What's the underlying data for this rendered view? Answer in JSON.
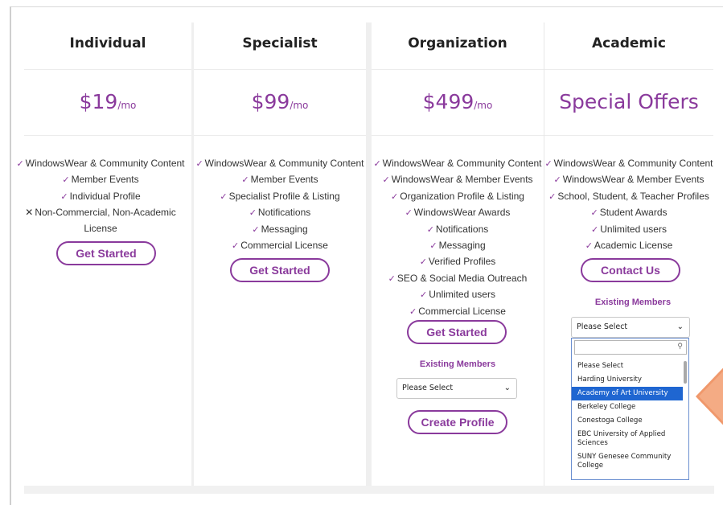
{
  "colors": {
    "accent": "#8a3a9c",
    "highlight": "#1f66d1",
    "pointer": "#f0986b"
  },
  "plans": [
    {
      "title": "Individual",
      "price": "$19",
      "unit": "/mo",
      "features": [
        {
          "icon": "check",
          "text": "WindowsWear & Community Content"
        },
        {
          "icon": "check",
          "text": "Member Events"
        },
        {
          "icon": "check",
          "text": "Individual Profile"
        },
        {
          "icon": "cross",
          "text": "Non-Commercial, Non-Academic"
        },
        {
          "icon": "none",
          "text": "License"
        }
      ],
      "button": "Get Started"
    },
    {
      "title": "Specialist",
      "price": "$99",
      "unit": "/mo",
      "features": [
        {
          "icon": "check",
          "text": "WindowsWear & Community Content"
        },
        {
          "icon": "check",
          "text": "Member Events"
        },
        {
          "icon": "check",
          "text": "Specialist Profile & Listing"
        },
        {
          "icon": "check",
          "text": "Notifications"
        },
        {
          "icon": "check",
          "text": "Messaging"
        },
        {
          "icon": "check",
          "text": "Commercial License"
        }
      ],
      "button": "Get Started"
    },
    {
      "title": "Organization",
      "price": "$499",
      "unit": "/mo",
      "features": [
        {
          "icon": "check",
          "text": "WindowsWear & Community Content"
        },
        {
          "icon": "check",
          "text": "WindowsWear & Member Events"
        },
        {
          "icon": "check",
          "text": "Organization Profile & Listing"
        },
        {
          "icon": "check",
          "text": "WindowsWear Awards"
        },
        {
          "icon": "check",
          "text": "Notifications"
        },
        {
          "icon": "check",
          "text": "Messaging"
        },
        {
          "icon": "check",
          "text": "Verified Profiles"
        },
        {
          "icon": "check",
          "text": "SEO & Social Media Outreach"
        },
        {
          "icon": "check",
          "text": "Unlimited users"
        },
        {
          "icon": "check",
          "text": "Commercial License"
        }
      ],
      "button": "Get Started",
      "existing_label": "Existing Members",
      "select_value": "Please Select",
      "secondary_button": "Create Profile"
    },
    {
      "title": "Academic",
      "price": "Special Offers",
      "unit": "",
      "features": [
        {
          "icon": "check",
          "text": "WindowsWear & Community Content"
        },
        {
          "icon": "check",
          "text": "WindowsWear & Member Events"
        },
        {
          "icon": "check",
          "text": "School, Student, & Teacher Profiles"
        },
        {
          "icon": "check",
          "text": "Student Awards"
        },
        {
          "icon": "check",
          "text": "Unlimited users"
        },
        {
          "icon": "check",
          "text": "Academic License"
        }
      ],
      "button": "Contact Us",
      "existing_label": "Existing Members",
      "select_value": "Please Select"
    }
  ],
  "dropdown": {
    "search_value": "",
    "options": [
      "Please Select",
      "Harding University",
      "Academy of Art University",
      "Berkeley College",
      "Conestoga College",
      "EBC University of Applied Sciences",
      "SUNY Genesee Community College"
    ],
    "highlighted_index": 2
  }
}
